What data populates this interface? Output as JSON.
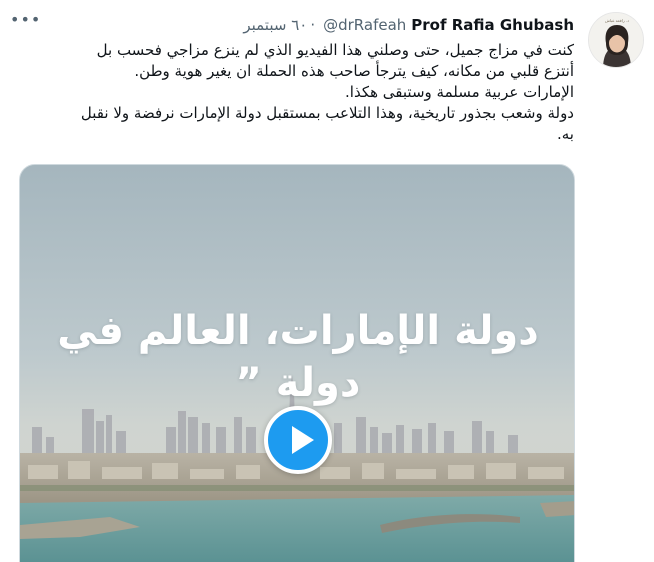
{
  "tweet": {
    "author": {
      "name": "Prof Rafia Ghubash",
      "handle": "@drRafeah",
      "avatar_caption": "د. رافعة غباش"
    },
    "date": "٦٠ سبتمبر",
    "separator": "·",
    "more_icon": "more-horizontal-icon",
    "text_lines": [
      "كنت في مزاج جميل، حتى وصلني هذا الفيديو الذي لم ينزع مزاجي فحسب بل",
      "أنتزع قلبي من مكانه، كيف يترجأ صاحب هذه الحملة ان يغير هوية وطن.",
      "الإمارات عربية مسلمة وستبقى هكذا.",
      "دولة وشعب بجذور تاريخية، وهذا التلاعب بمستقبل دولة الإمارات نرفضة ولا نقبل",
      "به."
    ],
    "media": {
      "overlay_text": "دولة الإمارات، العالم في دولة ”",
      "play_icon": "play-icon",
      "play_color": "#1d9bf0"
    }
  }
}
